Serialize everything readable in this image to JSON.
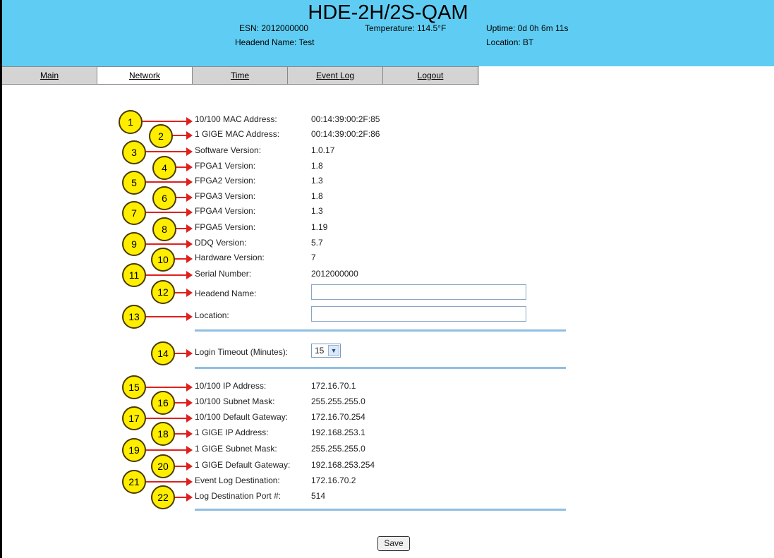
{
  "header": {
    "title": "HDE-2H/2S-QAM",
    "esn": "ESN: 2012000000",
    "headend": "Headend Name: Test",
    "temperature": "Temperature: 114.5°F",
    "uptime": "Uptime: 0d 0h 6m 11s",
    "location": "Location: BT"
  },
  "tabs": [
    "Main",
    "Network",
    "Time",
    "Event Log",
    "Logout"
  ],
  "fields": [
    {
      "n": "1",
      "label": "10/100 MAC Address:",
      "value": "00:14:39:00:2F:85"
    },
    {
      "n": "2",
      "label": "1 GIGE MAC Address:",
      "value": "00:14:39:00:2F:86"
    },
    {
      "n": "3",
      "label": "Software Version:",
      "value": "1.0.17"
    },
    {
      "n": "4",
      "label": "FPGA1 Version:",
      "value": "1.8"
    },
    {
      "n": "5",
      "label": "FPGA2 Version:",
      "value": "1.3"
    },
    {
      "n": "6",
      "label": "FPGA3 Version:",
      "value": "1.8"
    },
    {
      "n": "7",
      "label": "FPGA4 Version:",
      "value": "1.3"
    },
    {
      "n": "8",
      "label": "FPGA5 Version:",
      "value": "1.19"
    },
    {
      "n": "9",
      "label": "DDQ Version:",
      "value": "5.7"
    },
    {
      "n": "10",
      "label": "Hardware Version:",
      "value": "7"
    },
    {
      "n": "11",
      "label": "Serial Number:",
      "value": "2012000000"
    },
    {
      "n": "12",
      "label": "Headend Name:",
      "value": ""
    },
    {
      "n": "13",
      "label": "Location:",
      "value": ""
    },
    {
      "n": "14",
      "label": "Login Timeout (Minutes):",
      "value": "15"
    },
    {
      "n": "15",
      "label": "10/100 IP Address:",
      "value": "172.16.70.1"
    },
    {
      "n": "16",
      "label": "10/100 Subnet Mask:",
      "value": "255.255.255.0"
    },
    {
      "n": "17",
      "label": "10/100 Default Gateway:",
      "value": "172.16.70.254"
    },
    {
      "n": "18",
      "label": "1 GIGE IP Address:",
      "value": "192.168.253.1"
    },
    {
      "n": "19",
      "label": "1 GIGE Subnet Mask:",
      "value": "255.255.255.0"
    },
    {
      "n": "20",
      "label": "1 GIGE Default Gateway:",
      "value": "192.168.253.254"
    },
    {
      "n": "21",
      "label": "Event Log Destination:",
      "value": "172.16.70.2"
    },
    {
      "n": "22",
      "label": "Log Destination Port #:",
      "value": "514"
    }
  ],
  "save_label": "Save",
  "colors": {
    "header_bg": "#5fcdf3",
    "badge": "#ffee00",
    "arrow": "#e0201d",
    "separator": "#8fbee3"
  }
}
